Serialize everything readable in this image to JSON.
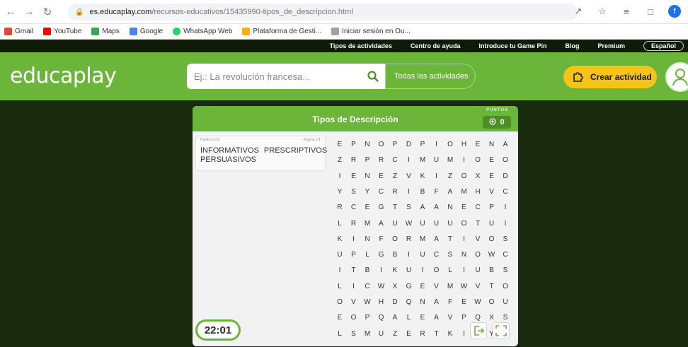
{
  "browser": {
    "url_domain": "es.educaplay.com",
    "url_path": "/recursos-educativos/15435990-tipos_de_descripcion.html",
    "profile_letter": "f"
  },
  "bookmarks": [
    {
      "label": "Gmail",
      "color": "#ea4335"
    },
    {
      "label": "YouTube",
      "color": "#ff0000"
    },
    {
      "label": "Maps",
      "color": "#34a853"
    },
    {
      "label": "Google",
      "color": "#4285f4"
    },
    {
      "label": "WhatsApp Web",
      "color": "#25d366"
    },
    {
      "label": "Plataforma de Gesti...",
      "color": "#f4b400"
    },
    {
      "label": "Iniciar sesión en Ou...",
      "color": "#a0a0a0"
    }
  ],
  "topnav": {
    "items": [
      "Tipos de actividades",
      "Centro de ayuda",
      "Introduce tu Game Pin",
      "Blog",
      "Premium"
    ],
    "language": "Español"
  },
  "header": {
    "logo": "educaplay",
    "search_placeholder": "Ej.: La revolución francesa...",
    "category": "Todas las actividades",
    "create_label": "Crear actividad"
  },
  "game": {
    "title": "Tipos de Descripción",
    "points_label": "PUNTOS",
    "points": "0",
    "words_counter": "Palabras 0/3",
    "page_counter": "Página 1/1",
    "words": [
      "INFORMATIVOS",
      "PRESCRIPTIVOS",
      "PERSUASIVOS"
    ],
    "timer": "22:01",
    "grid": [
      "EPNOPDPIOHENA",
      "ZRPRCIMUMIOEO",
      "IENEZVKIZOXED",
      "YSYCRIBFAMHVC",
      "RCEGTSAANECPI",
      "LRMAUWUUUOTUI",
      "KINFORMATIVOS",
      "UPLGBIUCSNOWC",
      "ITBIKUIOLIUBS",
      "LICWXGEVMWVTO",
      "OVWHDQNAFEWOU",
      "EOPQALEAVPQXS",
      "LSMUZERTKIJYU"
    ]
  },
  "colors": {
    "green": "#6bb53a",
    "dark": "#1a2a0f",
    "yellow": "#f4c416"
  }
}
